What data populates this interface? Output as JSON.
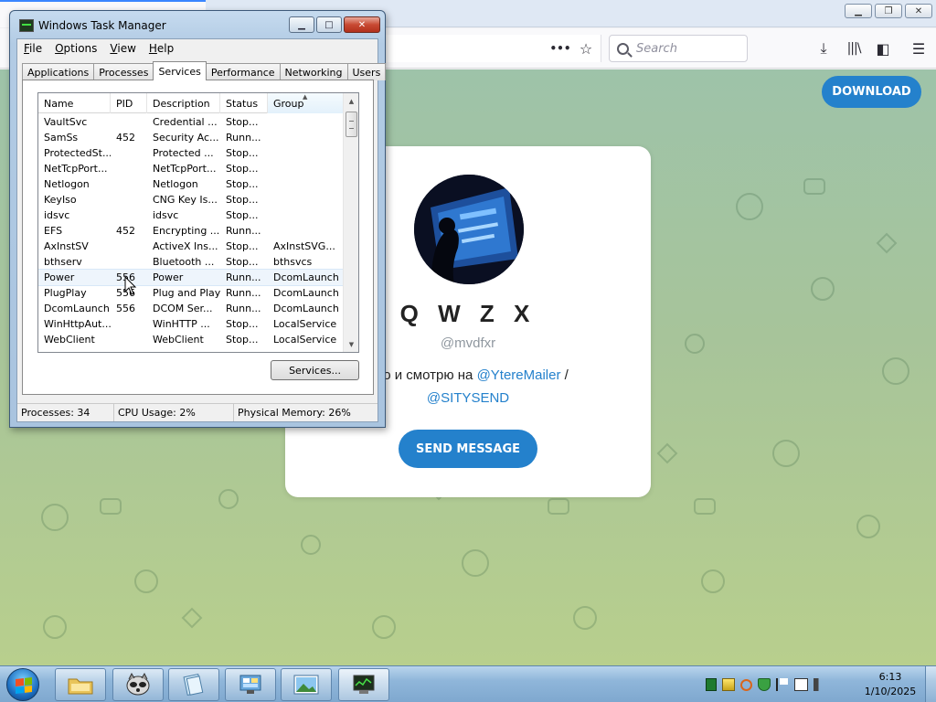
{
  "browser": {
    "toolbar": {
      "search_placeholder": "Search",
      "page_actions_icon": "•••"
    },
    "page": {
      "download_label": "DOWNLOAD",
      "profile_name": "Q W Z X",
      "username": "@mvdfxr",
      "bio_text": "део и смотрю на ",
      "bio_link1": "@YtereMailer",
      "bio_sep": " /",
      "bio_link2": "@SITYSEND",
      "send_label": "SEND MESSAGE"
    },
    "colors": {
      "accent": "#2481cc",
      "bg_green": "#a7c49a"
    }
  },
  "taskmgr": {
    "title": "Windows Task Manager",
    "window_buttons": {
      "minimize": "▁",
      "maximize": "□",
      "close": "✕"
    },
    "menu": [
      "File",
      "Options",
      "View",
      "Help"
    ],
    "tabs": [
      {
        "label": "Applications",
        "active": false
      },
      {
        "label": "Processes",
        "active": false
      },
      {
        "label": "Services",
        "active": true
      },
      {
        "label": "Performance",
        "active": false
      },
      {
        "label": "Networking",
        "active": false
      },
      {
        "label": "Users",
        "active": false
      }
    ],
    "columns": [
      "Name",
      "PID",
      "Description",
      "Status",
      "Group"
    ],
    "sorted_column": "Group",
    "rows": [
      [
        "VaultSvc",
        "",
        "Credential ...",
        "Stop...",
        ""
      ],
      [
        "SamSs",
        "452",
        "Security Ac...",
        "Runn...",
        ""
      ],
      [
        "ProtectedSt...",
        "",
        "Protected ...",
        "Stop...",
        ""
      ],
      [
        "NetTcpPort...",
        "",
        "NetTcpPort...",
        "Stop...",
        ""
      ],
      [
        "Netlogon",
        "",
        "Netlogon",
        "Stop...",
        ""
      ],
      [
        "KeyIso",
        "",
        "CNG Key Is...",
        "Stop...",
        ""
      ],
      [
        "idsvc",
        "",
        "idsvc",
        "Stop...",
        ""
      ],
      [
        "EFS",
        "452",
        "Encrypting ...",
        "Runn...",
        ""
      ],
      [
        "AxInstSV",
        "",
        "ActiveX Ins...",
        "Stop...",
        "AxInstSVG..."
      ],
      [
        "bthserv",
        "",
        "Bluetooth ...",
        "Stop...",
        "bthsvcs"
      ],
      [
        "Power",
        "556",
        "Power",
        "Runn...",
        "DcomLaunch"
      ],
      [
        "PlugPlay",
        "556",
        "Plug and Play",
        "Runn...",
        "DcomLaunch"
      ],
      [
        "DcomLaunch",
        "556",
        "DCOM Ser...",
        "Runn...",
        "DcomLaunch"
      ],
      [
        "WinHttpAut...",
        "",
        "WinHTTP ...",
        "Stop...",
        "LocalService"
      ],
      [
        "WebClient",
        "",
        "WebClient",
        "Stop...",
        "LocalService"
      ]
    ],
    "hover_row": 10,
    "services_button": "Services...",
    "status": {
      "processes": "Processes: 34",
      "cpu": "CPU Usage: 2%",
      "memory": "Physical Memory: 26%"
    }
  },
  "taskbar": {
    "clock_time": "6:13",
    "clock_date": "1/10/2025",
    "pinned": [
      "explorer-icon",
      "raccoon-app-icon",
      "notepad-icon",
      "control-panel-icon",
      "image-viewer-icon",
      "task-manager-icon"
    ]
  }
}
